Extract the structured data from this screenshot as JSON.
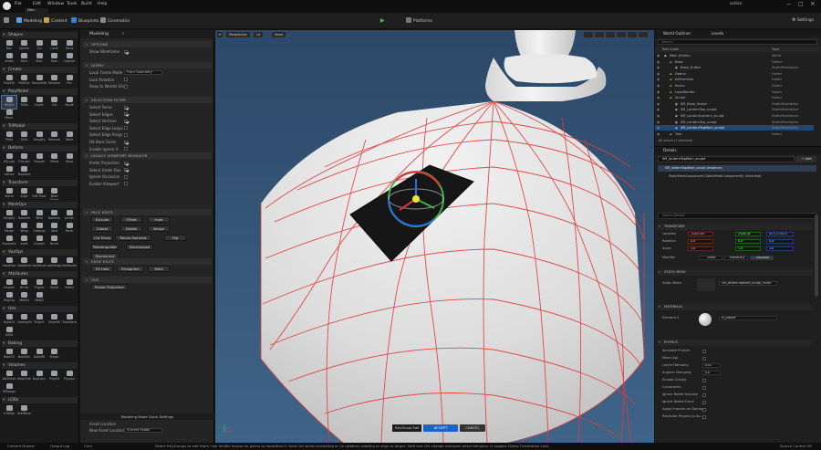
{
  "app": {
    "tab_title": "Main",
    "window_title": "action",
    "settings_label": "Settings"
  },
  "menu": [
    "File",
    "Edit",
    "Window",
    "Tools",
    "Build",
    "Help"
  ],
  "toolbar": {
    "select_mode": "Modeling",
    "content": "Content",
    "blueprints": "Blueprints",
    "cinematics": "Cinematics",
    "platforms": "Platforms"
  },
  "palette": {
    "categories": [
      "Shapes",
      "Create",
      "PolyModel",
      "TriModel",
      "Deform",
      "Transform",
      "MeshOps",
      "VoxOps",
      "Attributes",
      "UVs",
      "Baking",
      "Volumes",
      "LODs"
    ],
    "shapes_tools": [
      "Box",
      "Sphere",
      "Cyl",
      "Cone",
      "Torus",
      "Arrow",
      "Rect",
      "Disc",
      "Stair",
      "Capsule"
    ],
    "create_tools": [
      "PolyExt",
      "PathExt",
      "RevolveBoundary",
      "Revolve",
      "Pen"
    ],
    "polymodel_tools": [
      "PolyEd",
      "TriSel",
      "Insert",
      "Cut",
      "Bevel",
      "Mirror"
    ],
    "trimodel_tools": [
      "TriSel",
      "TriEd",
      "Simplify",
      "Remesh",
      "Weld"
    ],
    "deform_tools": [
      "VSculpt",
      "DSculpt",
      "Smooth",
      "Offset",
      "Warp",
      "Lattice",
      "Displace"
    ],
    "transform_tools": [
      "Xform",
      "Align",
      "Edit Pivot",
      "Bake Xform"
    ],
    "meshops_tools": [
      "Simplify",
      "Remesh",
      "Weld",
      "Boolean",
      "Jacket",
      "Merge",
      "Wrap",
      "Cleanup",
      "Split",
      "Patch",
      "Duplicate",
      "Inset",
      "Inspect",
      "Nrmls"
    ],
    "voxops_tools": [
      "VoxWrap",
      "VoxBlend",
      "VoxMorph",
      "VoxMerge",
      "VoxBoolean"
    ],
    "attributes_tools": [
      "Inspect",
      "Nrmls",
      "Tngnts",
      "Attrib",
      "Select",
      "PolyGrp",
      "MatEd",
      "MatID"
    ],
    "uvs_tools": [
      "AutoUV",
      "UnwrapUV",
      "Project",
      "SeamEd",
      "Transform",
      "UVEd"
    ],
    "baking_tools": [
      "BakeTx",
      "BakeVtx",
      "BakeRR",
      "Shape"
    ],
    "volumes_tools": [
      "Vol2Mesh",
      "Mesh2Vol",
      "BspConv",
      "PhysEd",
      "Physics",
      "SPAssign"
    ],
    "lods_tools": [
      "LODMgr",
      "SkelMesh"
    ]
  },
  "modeling": {
    "tab": "Modeling",
    "sections": {
      "options": "OPTIONS",
      "gizmo": "GIZMO",
      "selection_filter": "SELECTION FILTER",
      "viewport": "LEGACY VIEWPORT BEHAVIOR",
      "face_edits": "FACE EDITS",
      "edge_edits": "EDGE EDITS",
      "uvs": "UVS"
    },
    "options_rows": [
      {
        "label": "Show Wireframe",
        "on": true
      }
    ],
    "gizmo_rows": [
      {
        "label": "Local Frame Mode",
        "value": "From Geometry"
      },
      {
        "label": "Lock Rotation",
        "on": false
      },
      {
        "label": "Snap to Worlds Grid",
        "on": false
      }
    ],
    "filter_rows": [
      {
        "label": "Select Faces",
        "on": true
      },
      {
        "label": "Select Edges",
        "on": true
      },
      {
        "label": "Select Vertices",
        "on": true
      },
      {
        "label": "Select Edge Loops",
        "on": false
      },
      {
        "label": "Select Edge Rings",
        "on": false
      },
      {
        "label": "Hit Back Faces",
        "on": true
      },
      {
        "label": "Enable Ignore X",
        "on": false
      }
    ],
    "viewport_rows": [
      {
        "label": "Prefer Projection",
        "on": true
      },
      {
        "label": "Select Under Box",
        "on": true
      },
      {
        "label": "Ignore Occlusion",
        "on": false
      },
      {
        "label": "Enable Viewport",
        "on": false
      }
    ],
    "face_buttons": [
      "Extrude",
      "Offset",
      "Inset",
      "Outset",
      "Delete",
      "Merge",
      "Cut Faces",
      "Recalc Normals",
      "Flip",
      "Retriangulate",
      "Decompose",
      "Disconnect"
    ],
    "edge_buttons": [
      "Fill Hole",
      "Straighten",
      "Weld"
    ],
    "uv_buttons": [
      "Planar Projection"
    ],
    "footer_title": "Modeling Mode Quick Settings",
    "footer_rows": [
      {
        "label": "Asset Location",
        "value": ""
      },
      {
        "label": "New Asset Location",
        "value": "Current Folder"
      }
    ]
  },
  "viewport": {
    "buttons": [
      "Perspective",
      "Lit",
      "Show"
    ],
    "accept": "ACCEPT",
    "cancel": "CANCEL",
    "poly_edit_label": "PolyGroup Edit"
  },
  "outliner": {
    "title": "World Outliner",
    "tab2": "Levels",
    "search_placeholder": "Search...",
    "col_label": "Item Label",
    "col_type": "Type",
    "rows": [
      {
        "label": "Main (Editor)",
        "type": "World"
      },
      {
        "label": "Base",
        "type": "Folder"
      },
      {
        "label": "Base_Gutter",
        "type": "StaticMeshActor"
      },
      {
        "label": "Debris",
        "type": "Folder"
      },
      {
        "label": "AllPrimitive",
        "type": "Folder"
      },
      {
        "label": "Rocks",
        "type": "Folder"
      },
      {
        "label": "LevelBorder",
        "type": "Folder"
      },
      {
        "label": "Sculpt",
        "type": "Folder"
      },
      {
        "label": "SM_Base_Sculpt",
        "type": "StaticMeshActor"
      },
      {
        "label": "SM_LanternTop_sculpt",
        "type": "StaticMeshActor"
      },
      {
        "label": "SM_LanternLantern_sculpt",
        "type": "StaticMeshActor"
      },
      {
        "label": "SM_LanternTop_sculpt",
        "type": "StaticMeshActor"
      },
      {
        "label": "SM_LanternTopMain_sculpt",
        "type": "StaticMeshActor"
      },
      {
        "label": "Tree",
        "type": "Folder"
      }
    ],
    "count": "85 actors (1 selected)"
  },
  "details": {
    "title": "Details",
    "actor_name": "SM_lanternTopMain_sculpt",
    "add": "+ Add",
    "component_root": "SM_lanternTopMain_sculpt (Instance)",
    "component_child": "StaticMeshComponent (StaticMeshComponent0) (Inherited)",
    "search_placeholder": "Search Details",
    "transform_label": "TRANSFORM",
    "location": {
      "label": "Location",
      "x": "-3283.04",
      "y": "3108.04",
      "z": "417.273072"
    },
    "rotation": {
      "label": "Rotation",
      "x": "0.0°",
      "y": "0.0°",
      "z": "0.0°"
    },
    "scale": {
      "label": "Scale",
      "x": "1.0",
      "y": "1.0",
      "z": "1.0"
    },
    "mobility": {
      "label": "Mobility",
      "options": [
        "Static",
        "Stationary",
        "Movable"
      ]
    },
    "static_mesh_label": "STATIC MESH",
    "static_mesh_row": "Static Mesh",
    "static_mesh_value": "SM_lanternTopMain_sculpt_Polish",
    "materials_label": "MATERIALS",
    "element0": "Element 0",
    "material_value": "M_plaster",
    "physics_label": "PHYSICS",
    "physics_rows": [
      {
        "label": "Simulate Physics",
        "value": ""
      },
      {
        "label": "Mass (kg)",
        "value": ""
      },
      {
        "label": "Linear Damping",
        "value": "0.01"
      },
      {
        "label": "Angular Damping",
        "value": "0.0"
      },
      {
        "label": "Enable Gravity",
        "value": ""
      },
      {
        "label": "Constraints",
        "value": ""
      },
      {
        "label": "Ignore Radial Impulse",
        "value": ""
      },
      {
        "label": "Ignore Radial Force",
        "value": ""
      },
      {
        "label": "Apply Impulse on Damage",
        "value": ""
      },
      {
        "label": "Replicate Physics to Au..",
        "value": ""
      }
    ]
  },
  "status": {
    "content_drawer": "Content Drawer",
    "output_log": "Output Log",
    "cmd": "Cmd",
    "hint": "Select PolyGroups to edit them. Use middle mouse on gizmo to reposition it. Hold Ctrl while translating or (in rotation) rotating to align to target. Shift and Ctrl change marquee select behavior. Q toggles Gizmo Orientation Lock.",
    "source_control": "Source Control Off"
  },
  "colors": {
    "accent": "#2a6fd6",
    "wire": "#e23a3a",
    "sky": "#3a5a7c",
    "selected_row": "#23466e"
  }
}
